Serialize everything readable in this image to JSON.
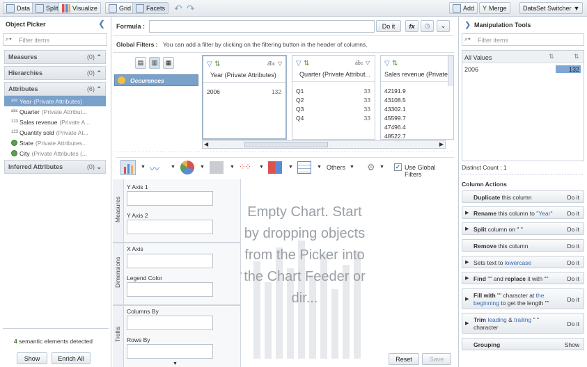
{
  "toolbar": {
    "data_label": "Data",
    "split_label": "Split",
    "visualize_label": "Visualize",
    "grid_label": "Grid",
    "facets_label": "Facets",
    "add_label": "Add",
    "merge_label": "Merge",
    "dataset_switcher_label": "DataSet Switcher"
  },
  "object_picker": {
    "title": "Object Picker",
    "filter_placeholder": "Filter items",
    "sections": [
      {
        "label": "Measures",
        "count": "(0)"
      },
      {
        "label": "Hierarchies",
        "count": "(0)"
      },
      {
        "label": "Attributes",
        "count": "(6)"
      },
      {
        "label": "Inferred Attributes",
        "count": "(0)"
      }
    ],
    "attributes": [
      {
        "icon": "abc",
        "name": "Year",
        "sub": "(Private Attributes)"
      },
      {
        "icon": "abc",
        "name": "Quarter",
        "sub": "(Private Attribut..."
      },
      {
        "icon": "123",
        "name": "Sales revenue",
        "sub": "(Private A..."
      },
      {
        "icon": "123",
        "name": "Quantity sold",
        "sub": "(Private At..."
      },
      {
        "icon": "geo",
        "name": "State",
        "sub": "(Private Attributes..."
      },
      {
        "icon": "geo",
        "name": "City",
        "sub": "(Private Attributes (..."
      }
    ],
    "semantic_count": "4",
    "semantic_text": "semantic elements detected",
    "show_label": "Show",
    "enrich_label": "Enrich All"
  },
  "formula": {
    "label": "Formula :",
    "value": "",
    "doit_label": "Do it"
  },
  "global_filters": {
    "label": "Global Filters :",
    "text": "You can add a filter by clicking on the filtering button in the header of columns."
  },
  "occurences_label": "Occurences",
  "facets": [
    {
      "title": "Year (Private Attributes)",
      "rows": [
        {
          "v": "2006",
          "n": "132"
        }
      ]
    },
    {
      "title": "Quarter (Private Attribut...",
      "rows": [
        {
          "v": "Q1",
          "n": "33"
        },
        {
          "v": "Q2",
          "n": "33"
        },
        {
          "v": "Q3",
          "n": "33"
        },
        {
          "v": "Q4",
          "n": "33"
        }
      ]
    },
    {
      "title": "Sales revenue (Private",
      "rows": [
        {
          "v": "42191.9",
          "n": ""
        },
        {
          "v": "43108.5",
          "n": ""
        },
        {
          "v": "43302.1",
          "n": ""
        },
        {
          "v": "45599.7",
          "n": ""
        },
        {
          "v": "47496.4",
          "n": ""
        },
        {
          "v": "48522.7",
          "n": ""
        }
      ]
    }
  ],
  "chart_toolbar": {
    "others_label": "Others",
    "use_global_filters_label": "Use Global Filters",
    "use_global_filters_checked": true
  },
  "feeder": {
    "measures_label": "Measures",
    "dimensions_label": "Dimensions",
    "trellis_label": "Trellis",
    "y1": "Y Axis 1",
    "y2": "Y Axis 2",
    "x": "X Axis",
    "legend": "Legend Color",
    "columns_by": "Columns By",
    "rows_by": "Rows By"
  },
  "empty_chart": "Empty Chart. Start by dropping objects from the Picker into the Chart Feeder or dir...",
  "reset_label": "Reset",
  "save_label": "Save",
  "manipulation": {
    "title": "Manipulation Tools",
    "filter_placeholder": "Filter items",
    "all_values_label": "All Values",
    "value": "2006",
    "count": "132",
    "distinct_count": "Distinct Count : 1",
    "column_actions_title": "Column Actions",
    "doit": "Do it",
    "grouping_label": "Grouping",
    "show_label": "Show"
  },
  "colors": {
    "selected": "#7aa1c9",
    "accent_blue": "#3a6ab0",
    "bar_fill": "#7fa7d3"
  }
}
